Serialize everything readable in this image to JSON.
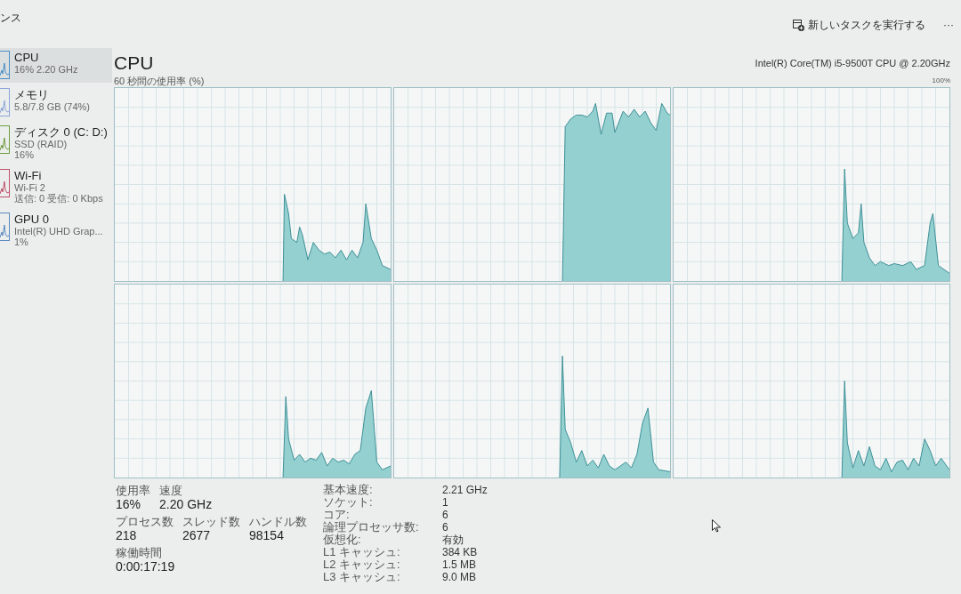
{
  "page_title": "ンス",
  "toolbar": {
    "run_task": "新しいタスクを実行する",
    "more": "···"
  },
  "sidebar": {
    "items": [
      {
        "name": "CPU",
        "details": [
          "16% 2.20 GHz"
        ],
        "color": "#4a90c8",
        "selected": true
      },
      {
        "name": "メモリ",
        "details": [
          "5.8/7.8 GB (74%)"
        ],
        "color": "#8aa6d8",
        "selected": false
      },
      {
        "name": "ディスク 0 (C: D:)",
        "details": [
          "SSD (RAID)",
          "16%"
        ],
        "color": "#6f9f3f",
        "selected": false
      },
      {
        "name": "Wi-Fi",
        "details": [
          "Wi-Fi 2",
          "送信: 0 受信: 0 Kbps"
        ],
        "color": "#c0506a",
        "selected": false
      },
      {
        "name": "GPU 0",
        "details": [
          "Intel(R) UHD Grap...",
          "1%"
        ],
        "color": "#5a8ac0",
        "selected": false
      }
    ]
  },
  "cpu": {
    "title": "CPU",
    "model": "Intel(R) Core(TM) i5-9500T CPU @ 2.20GHz",
    "graph_caption": "60 秒間の使用率 (%)",
    "graph_max": "100%",
    "stats": [
      [
        {
          "label": "使用率",
          "value": "16%"
        },
        {
          "label": "速度",
          "value": "2.20 GHz"
        }
      ],
      [
        {
          "label": "プロセス数",
          "value": "218"
        },
        {
          "label": "スレッド数",
          "value": "2677"
        },
        {
          "label": "ハンドル数",
          "value": "98154"
        }
      ],
      [
        {
          "label": "稼働時間",
          "value": "0:00:17:19"
        }
      ]
    ],
    "specs": [
      {
        "label": "基本速度:",
        "value": "2.21 GHz"
      },
      {
        "label": "ソケット:",
        "value": "1"
      },
      {
        "label": "コア:",
        "value": "6"
      },
      {
        "label": "論理プロセッサ数:",
        "value": "6"
      },
      {
        "label": "仮想化:",
        "value": "有効"
      },
      {
        "label": "L1 キャッシュ:",
        "value": "384 KB"
      },
      {
        "label": "L2 キャッシュ:",
        "value": "1.5 MB"
      },
      {
        "label": "L3 キャッシュ:",
        "value": "9.0 MB"
      }
    ]
  }
}
